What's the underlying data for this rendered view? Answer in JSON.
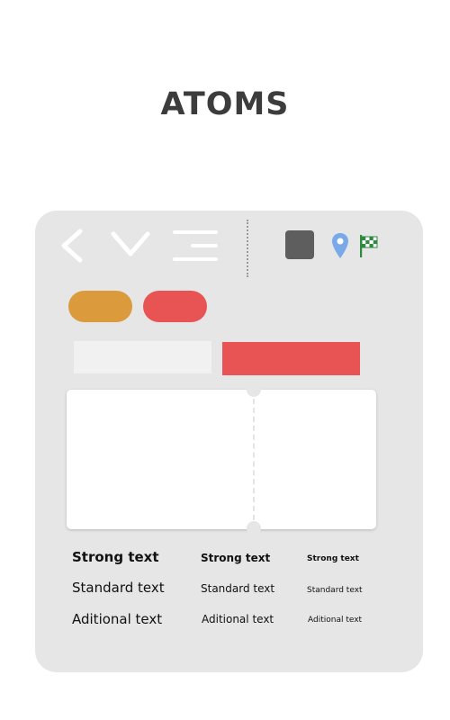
{
  "header": {
    "title": "ATOMS"
  },
  "colors": {
    "card_bg": "#e6e6e6",
    "orange": "#db9b3c",
    "red": "#e85353",
    "dark_gray": "#5e5e5e",
    "map_pin_blue": "#7aa9ea",
    "flag_green": "#2e8a3e"
  },
  "icons": {
    "back": "chevron-left-icon",
    "expand": "chevron-down-icon",
    "menu": "menu-icon",
    "stop": "stop-square-icon",
    "location": "map-pin-icon",
    "finish": "checkered-flag-icon"
  },
  "typography": {
    "large": {
      "strong": "Strong text",
      "standard": "Standard text",
      "additional": "Aditional text"
    },
    "medium": {
      "strong": "Strong text",
      "standard": "Standard text",
      "additional": "Aditional text"
    },
    "small": {
      "strong": "Strong text",
      "standard": "Standard text",
      "additional": "Aditional text"
    }
  }
}
